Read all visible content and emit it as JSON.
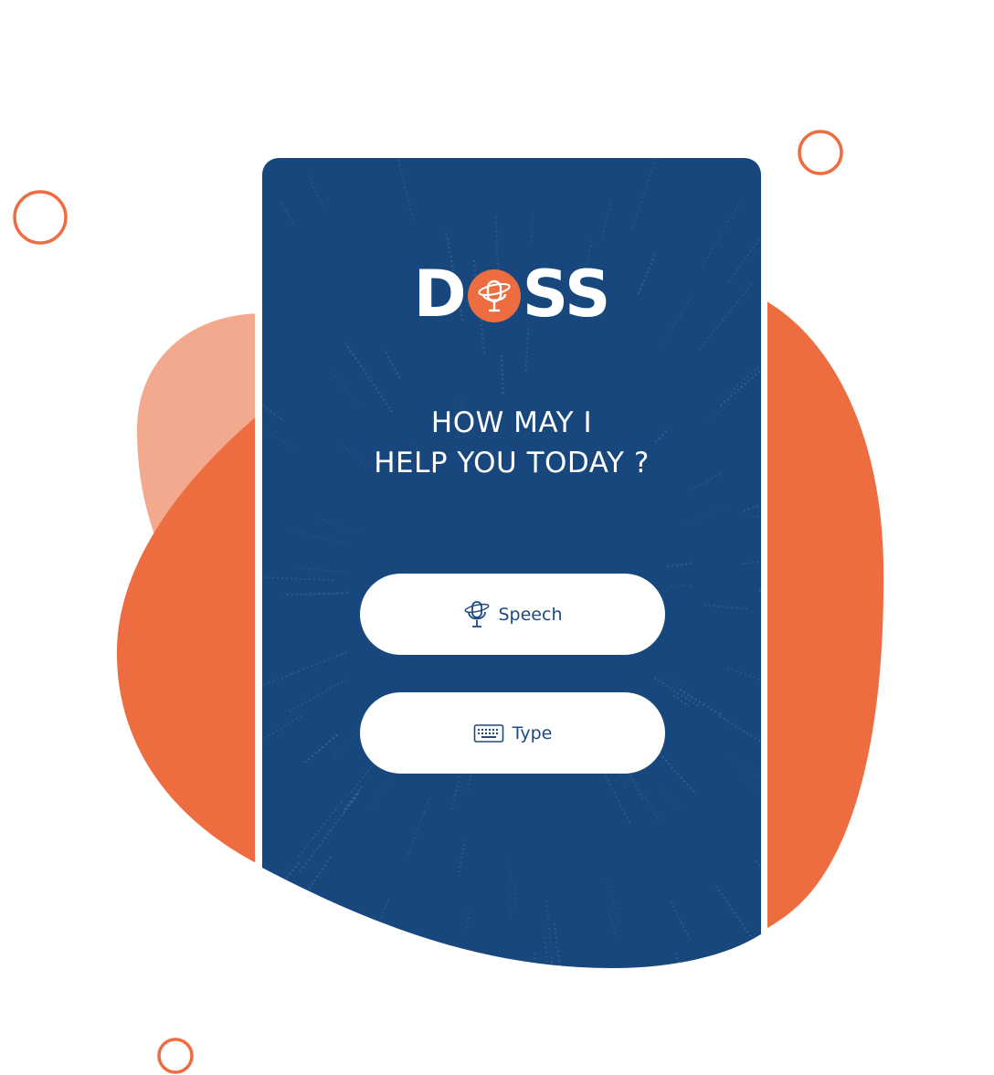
{
  "app": {
    "logo_text_left": "D",
    "logo_text_right": "SS",
    "heading_line1": "HOW MAY I",
    "heading_line2": "HELP YOU TODAY ?",
    "buttons": {
      "speech_label": "Speech",
      "type_label": "Type",
      "speech_icon": "microphone-icon",
      "type_icon": "keyboard-icon"
    }
  },
  "colors": {
    "brand_orange": "#ee6d40",
    "light_orange": "#f3a98d",
    "screen_blue": "#17477c",
    "button_text": "#1d4a82"
  }
}
